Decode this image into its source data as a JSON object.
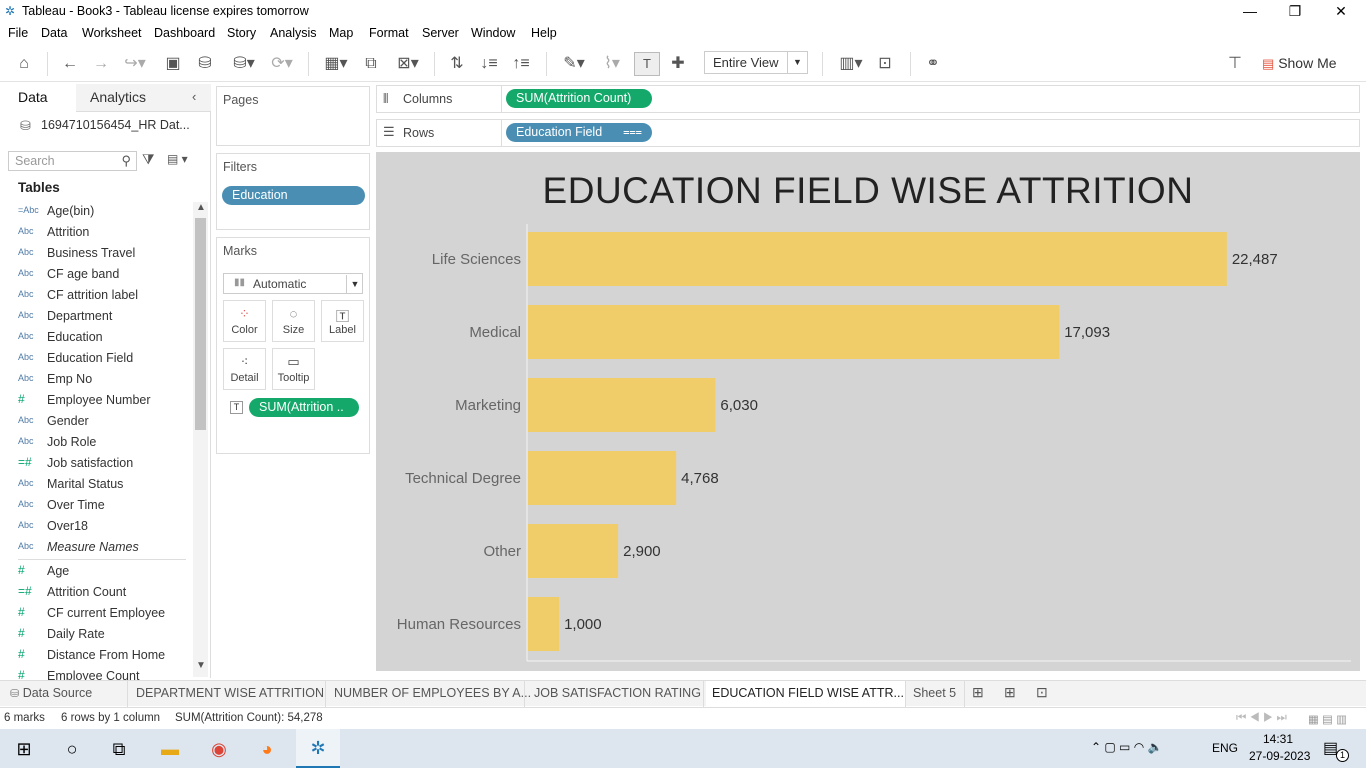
{
  "window": {
    "title": "Tableau - Book3 - Tableau license expires tomorrow"
  },
  "menu": [
    "File",
    "Data",
    "Worksheet",
    "Dashboard",
    "Story",
    "Analysis",
    "Map",
    "Format",
    "Server",
    "Window",
    "Help"
  ],
  "toolbar": {
    "fit_label": "Entire View",
    "show_me_label": "Show Me"
  },
  "datapane": {
    "tab_data": "Data",
    "tab_analytics": "Analytics",
    "datasource": "1694710156454_HR Dat...",
    "search_placeholder": "Search",
    "tables_label": "Tables",
    "fields": [
      {
        "icon": "=Abc",
        "label": "Age(bin)"
      },
      {
        "icon": "Abc",
        "label": "Attrition"
      },
      {
        "icon": "Abc",
        "label": "Business Travel"
      },
      {
        "icon": "Abc",
        "label": "CF age band"
      },
      {
        "icon": "Abc",
        "label": "CF attrition label"
      },
      {
        "icon": "Abc",
        "label": "Department"
      },
      {
        "icon": "Abc",
        "label": "Education"
      },
      {
        "icon": "Abc",
        "label": "Education Field"
      },
      {
        "icon": "Abc",
        "label": "Emp No"
      },
      {
        "icon": "#",
        "label": "Employee Number"
      },
      {
        "icon": "Abc",
        "label": "Gender"
      },
      {
        "icon": "Abc",
        "label": "Job Role"
      },
      {
        "icon": "=#",
        "label": "Job satisfaction"
      },
      {
        "icon": "Abc",
        "label": "Marital Status"
      },
      {
        "icon": "Abc",
        "label": "Over Time"
      },
      {
        "icon": "Abc",
        "label": "Over18"
      },
      {
        "icon": "Abc",
        "label": "Measure Names"
      }
    ],
    "measures": [
      {
        "icon": "#",
        "label": "Age"
      },
      {
        "icon": "=#",
        "label": "Attrition Count"
      },
      {
        "icon": "#",
        "label": "CF current Employee"
      },
      {
        "icon": "#",
        "label": "Daily Rate"
      },
      {
        "icon": "#",
        "label": "Distance From Home"
      },
      {
        "icon": "#",
        "label": "Employee Count"
      }
    ]
  },
  "shelves": {
    "pages_label": "Pages",
    "filters_label": "Filters",
    "filter_pill": "Education",
    "marks_label": "Marks",
    "mark_type": "Automatic",
    "mark_buttons": [
      "Color",
      "Size",
      "Label",
      "Detail",
      "Tooltip"
    ],
    "mark_pill": "SUM(Attrition ..",
    "columns_label": "Columns",
    "columns_pill": "SUM(Attrition Count)",
    "rows_label": "Rows",
    "rows_pill": "Education Field"
  },
  "chart_data": {
    "type": "bar",
    "orientation": "horizontal",
    "title": "EDUCATION FIELD WISE ATTRITION",
    "categories": [
      "Life Sciences",
      "Medical",
      "Marketing",
      "Technical Degree",
      "Other",
      "Human Resources"
    ],
    "values": [
      22487,
      17093,
      6030,
      4768,
      2900,
      1000
    ],
    "value_labels": [
      "22,487",
      "17,093",
      "6,030",
      "4,768",
      "2,900",
      "1,000"
    ],
    "bar_color": "#f0cd68",
    "background": "#d4d4d4",
    "xlim": [
      0,
      26000
    ]
  },
  "sheet_tabs": [
    "Data Source",
    "DEPARTMENT WISE ATTRITION",
    "NUMBER OF EMPLOYEES BY A...",
    "JOB SATISFACTION RATING",
    "EDUCATION FIELD WISE ATTR...",
    "Sheet 5"
  ],
  "active_tab_index": 4,
  "status": {
    "marks": "6 marks",
    "rows_cols": "6 rows by 1 column",
    "sum": "SUM(Attrition Count): 54,278"
  },
  "taskbar": {
    "lang": "ENG",
    "time": "14:31",
    "date": "27-09-2023",
    "notifications": "1"
  }
}
